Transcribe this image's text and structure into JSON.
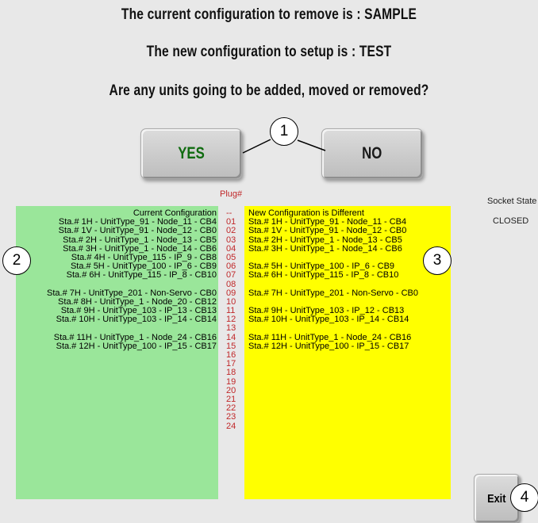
{
  "header": {
    "remove_line": "The current configuration to remove is :   SAMPLE",
    "setup_line": "The new configuration to setup is :   TEST",
    "question": "Are any units going to be added, moved or removed?"
  },
  "buttons": {
    "yes": "YES",
    "no": "NO",
    "exit": "Exit"
  },
  "callouts": [
    "1",
    "2",
    "3",
    "4"
  ],
  "plug_header": "Plug#",
  "plugs": [
    "--",
    "01",
    "02",
    "03",
    "04",
    "05",
    "06",
    "07",
    "08",
    "09",
    "10",
    "11",
    "12",
    "13",
    "14",
    "15",
    "16",
    "17",
    "18",
    "19",
    "20",
    "21",
    "22",
    "23",
    "24"
  ],
  "current": {
    "title": "Current Configuration",
    "rows": [
      "Sta.# 1H - UnitType_91 - Node_11 - CB4",
      "Sta.# 1V - UnitType_91 - Node_12 - CB0",
      "Sta.# 2H - UnitType_1 - Node_13 - CB5",
      "Sta.# 3H - UnitType_1 - Node_14 - CB6",
      "Sta.# 4H - UnitType_115 - IP_9 - CB8",
      "Sta.# 5H - UnitType_100 - IP_6 - CB9",
      "Sta.# 6H - UnitType_115 - IP_8 - CB10",
      "",
      "Sta.# 7H - UnitType_201 - Non-Servo - CB0",
      "Sta.# 8H - UnitType_1 - Node_20 - CB12",
      "Sta.# 9H - UnitType_103 - IP_13 - CB13",
      "Sta.# 10H - UnitType_103 - IP_14 - CB14",
      "",
      "Sta.# 11H - UnitType_1 - Node_24 - CB16",
      "Sta.# 12H - UnitType_100 - IP_15 - CB17"
    ]
  },
  "new_config": {
    "title": "New Configuration is Different",
    "rows": [
      "Sta.# 1H - UnitType_91 - Node_11 - CB4",
      "Sta.# 1V - UnitType_91 - Node_12 - CB0",
      "Sta.# 2H - UnitType_1 - Node_13 - CB5",
      "Sta.# 3H - UnitType_1 - Node_14 - CB6",
      "",
      "Sta.# 5H - UnitType_100 - IP_6 - CB9",
      "Sta.# 6H - UnitType_115 - IP_8 - CB10",
      "",
      "Sta.# 7H - UnitType_201 - Non-Servo - CB0",
      "",
      "Sta.# 9H - UnitType_103 - IP_12 - CB13",
      "Sta.# 10H - UnitType_103 - IP_14 - CB14",
      "",
      "Sta.# 11H - UnitType_1 - Node_24 - CB16",
      "Sta.# 12H - UnitType_100 - IP_15 - CB17"
    ]
  },
  "socket": {
    "label": "Socket State",
    "value": "CLOSED"
  }
}
